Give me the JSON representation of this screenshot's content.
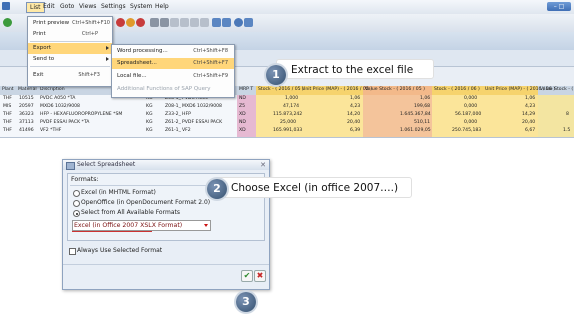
{
  "menubar": {
    "items": [
      "List",
      "Edit",
      "Goto",
      "Views",
      "Settings",
      "System",
      "Help"
    ]
  },
  "list_menu": {
    "items": [
      {
        "label": "Print preview",
        "shortcut": "Ctrl+Shift+F10"
      },
      {
        "label": "Print",
        "shortcut": "Ctrl+P"
      },
      {
        "label": "Export",
        "shortcut": ""
      },
      {
        "label": "Send to",
        "shortcut": ""
      },
      {
        "label": "Exit",
        "shortcut": "Shift+F3"
      }
    ]
  },
  "export_menu": {
    "items": [
      {
        "label": "Word processing...",
        "shortcut": "Ctrl+Shift+F8"
      },
      {
        "label": "Spreadsheet...",
        "shortcut": "Ctrl+Shift+F7"
      },
      {
        "label": "Local file...",
        "shortcut": "Ctrl+Shift+F9"
      },
      {
        "label": "Additional Functions of SAP Query",
        "shortcut": ""
      }
    ]
  },
  "table": {
    "headers": [
      "Plant",
      "Material",
      "Discription",
      "",
      "",
      "ption",
      "MRP T",
      "Stock - ( 2016 / 05 )",
      "Unit Price (MAP) - ( 2016 / 05 )",
      "Value Stock - ( 2016 / 05 )",
      "Stock - ( 2016 / 06 )",
      "Unit Price (MAP) - ( 2016 / 06 )",
      "Value Stock - ("
    ],
    "rows": [
      [
        "THF",
        "10515",
        "PVDC A050 *TA",
        "KG",
        "Z08-1_",
        "PVDC A050",
        "ND",
        "1,000",
        "1,06",
        "1,06",
        "0,000",
        "1,06",
        ""
      ],
      [
        "MIS",
        "20597",
        "MXD6 1032/9008",
        "KG",
        "Z08-1_",
        "MXD6 1032/9008",
        "Z5",
        "47,174",
        "4,23",
        "199,68",
        "0,000",
        "4,23",
        ""
      ],
      [
        "THF",
        "36323",
        "HFP - HEXAFLUOROPROPYLENE *SM",
        "KG",
        "Z33-2_",
        "HFP",
        "XD",
        "115.873,242",
        "14,20",
        "1.645.367,84",
        "56.187,000",
        "14,29",
        "8"
      ],
      [
        "THF",
        "37113",
        "PVDF ESSAI PACK *TA",
        "KG",
        "Z61-2_",
        "PVDF ESSAI PACK",
        "ND",
        "25,000",
        "20,40",
        "510,11",
        "0,000",
        "20,40",
        ""
      ],
      [
        "THF",
        "41496",
        "VF2 *THF",
        "KG",
        "Z61-1_",
        "VF2",
        "XD",
        "165.991,033",
        "6,39",
        "1.061.029,05",
        "250.745,183",
        "6,67",
        "1.5"
      ]
    ]
  },
  "callouts": [
    {
      "number": "1",
      "text": "Extract to the excel file"
    },
    {
      "number": "2",
      "text": "Choose Excel (in office 2007….)"
    },
    {
      "number": "3",
      "text": ""
    }
  ],
  "dialog": {
    "title": "Select Spreadsheet",
    "group_label": "Formats:",
    "options": [
      "Excel (in MHTML Format)",
      "OpenOffice (in OpenDocument Format 2.0)",
      "Select from All Available Formats"
    ],
    "selected_format": "Excel (in Office 2007 XSLX Format)",
    "always_use": "Always Use Selected Format"
  }
}
